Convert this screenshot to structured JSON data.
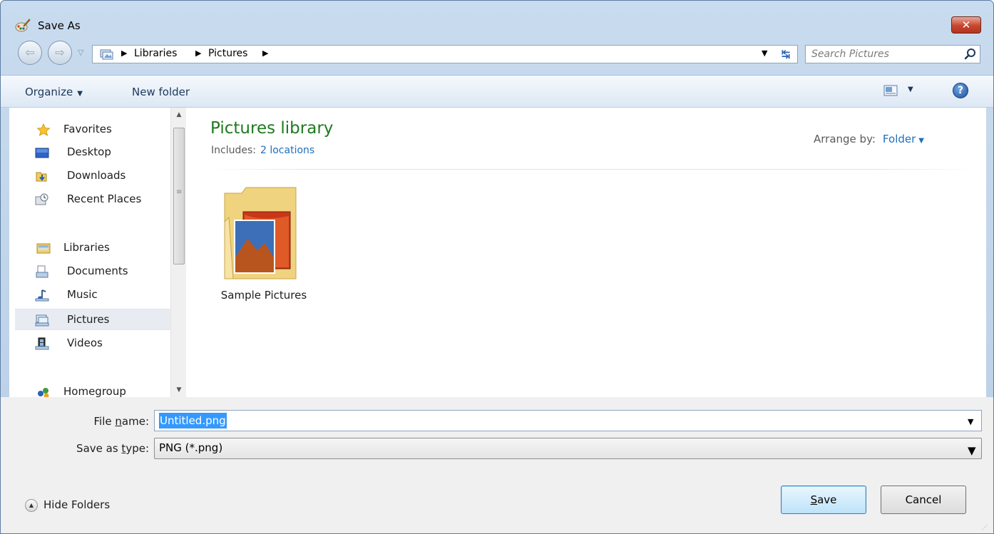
{
  "window": {
    "title": "Save As",
    "close_glyph": "✕"
  },
  "address": {
    "back_glyph": "⇦",
    "forward_glyph": "⇨",
    "history_glyph": "▽",
    "separator_glyph": "▶",
    "breadcrumbs": [
      "Libraries",
      "Pictures"
    ],
    "dropdown_glyph": "▼",
    "refresh_glyph": "↹"
  },
  "search": {
    "placeholder": "Search Pictures",
    "icon": "search-icon"
  },
  "toolbar": {
    "organize_label": "Organize",
    "organize_caret": "▼",
    "new_folder_label": "New folder",
    "view_caret": "▼",
    "help_glyph": "?"
  },
  "sidebar": {
    "favorites": {
      "label": "Favorites",
      "icon": "star-icon",
      "items": [
        {
          "label": "Desktop",
          "icon": "desktop-icon"
        },
        {
          "label": "Downloads",
          "icon": "downloads-icon"
        },
        {
          "label": "Recent Places",
          "icon": "recent-places-icon"
        }
      ]
    },
    "libraries": {
      "label": "Libraries",
      "icon": "libraries-icon",
      "items": [
        {
          "label": "Documents",
          "icon": "documents-icon"
        },
        {
          "label": "Music",
          "icon": "music-icon"
        },
        {
          "label": "Pictures",
          "icon": "pictures-icon",
          "selected": true
        },
        {
          "label": "Videos",
          "icon": "videos-icon"
        }
      ]
    },
    "homegroup": {
      "label": "Homegroup",
      "icon": "homegroup-icon"
    },
    "scroll_up_glyph": "▲",
    "scroll_down_glyph": "▼",
    "scroll_grip_glyph": "≡"
  },
  "library": {
    "title": "Pictures library",
    "includes_label": "Includes:",
    "locations": "2 locations",
    "arrange_label": "Arrange by:",
    "arrange_value": "Folder",
    "arrange_caret": "▼"
  },
  "items": [
    {
      "label": "Sample Pictures",
      "icon": "folder-icon"
    }
  ],
  "form": {
    "filename_label_pre": "File ",
    "filename_label_key": "n",
    "filename_label_post": "ame:",
    "filename_value": "Untitled.png",
    "type_label_pre": "Save as ",
    "type_label_key": "t",
    "type_label_post": "ype:",
    "type_value": "PNG (*.png)",
    "combo_caret": "▼"
  },
  "footer": {
    "hide_folders_label": "Hide Folders",
    "hide_folders_glyph": "▲",
    "save_label_key": "S",
    "save_label_rest": "ave",
    "cancel_label": "Cancel",
    "grip_glyph": "⋰"
  },
  "colors": {
    "library_title": "#1e7a1e",
    "link": "#1f6fbd",
    "selection": "#3399ff",
    "close_button": "#c7462f"
  }
}
